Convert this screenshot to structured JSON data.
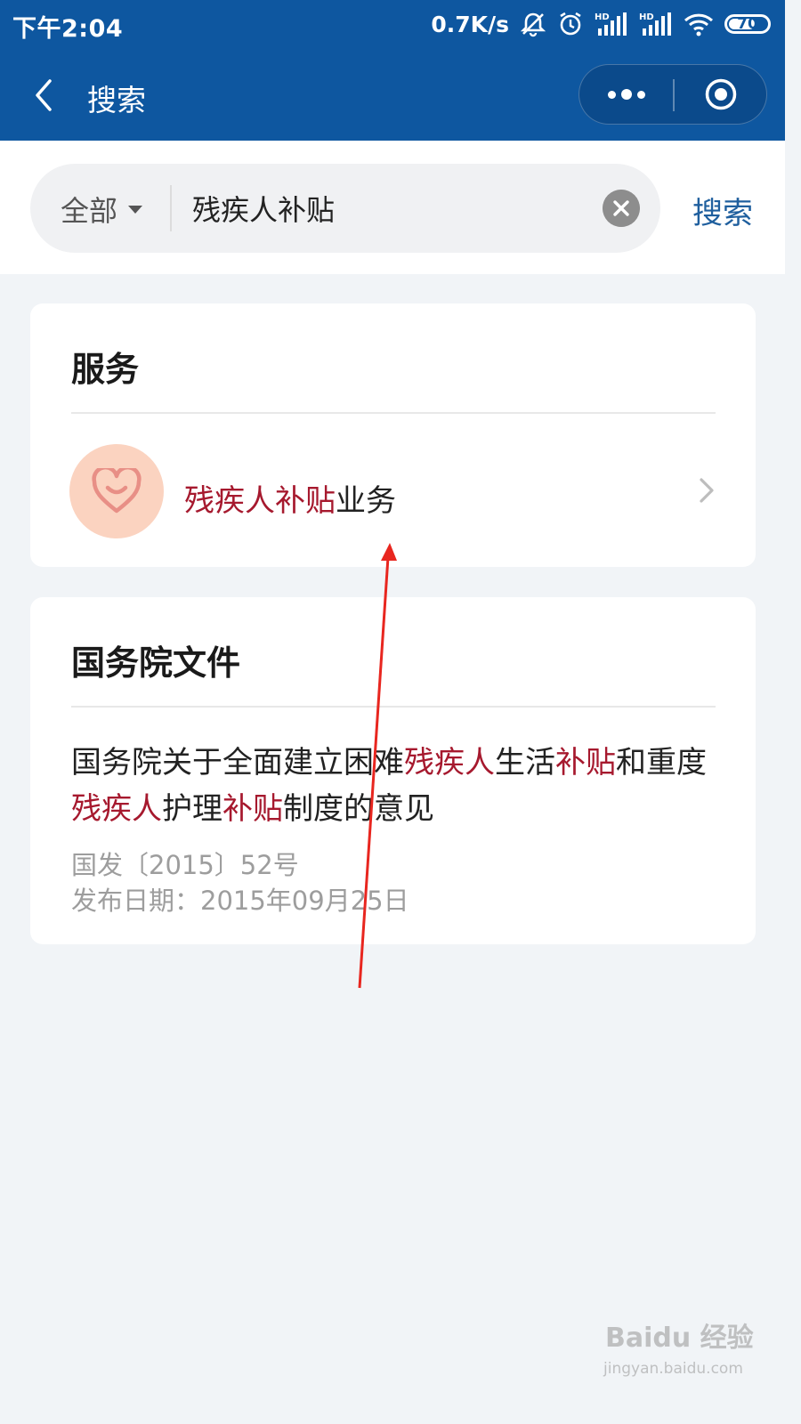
{
  "status_bar": {
    "time": "下午2:04",
    "net_speed": "0.7K/s",
    "battery": "70",
    "battery_level_percent": 70,
    "icons": [
      "mute-icon",
      "alarm-icon",
      "hd-signal-icon",
      "hd-signal-icon",
      "wifi-icon",
      "battery-icon"
    ]
  },
  "nav": {
    "title": "搜索",
    "back_icon": "back-arrow-icon",
    "more_icon": "more-dots-icon",
    "close_icon": "target-circle-icon"
  },
  "search": {
    "scope": "全部",
    "query": "残疾人补贴",
    "button": "搜索",
    "clear_icon": "clear-icon"
  },
  "services": {
    "title": "服务",
    "item": {
      "label_highlight": "残疾人补贴",
      "label_rest": "业务",
      "icon": "heart-smile-icon"
    }
  },
  "state_council_docs": {
    "title": "国务院文件",
    "doc": {
      "title_parts": [
        {
          "text": "国务院关于全面建立困难",
          "hl": false
        },
        {
          "text": "残疾人",
          "hl": true
        },
        {
          "text": "生活",
          "hl": false
        },
        {
          "text": "补贴",
          "hl": true
        },
        {
          "text": "和重度",
          "hl": false
        },
        {
          "text": "残疾人",
          "hl": true
        },
        {
          "text": "护理",
          "hl": false
        },
        {
          "text": "补贴",
          "hl": true
        },
        {
          "text": "制度的意见",
          "hl": false
        }
      ],
      "doc_number": "国发〔2015〕52号",
      "publish_date": "发布日期：2015年09月25日"
    }
  },
  "watermark": {
    "brand": "Baidu 经验",
    "url": "jingyan.baidu.com"
  },
  "colors": {
    "nav_bg": "#0e57a0",
    "highlight": "#a6192e",
    "search_link": "#1f5f9e",
    "annotation_arrow": "#e8261f"
  }
}
